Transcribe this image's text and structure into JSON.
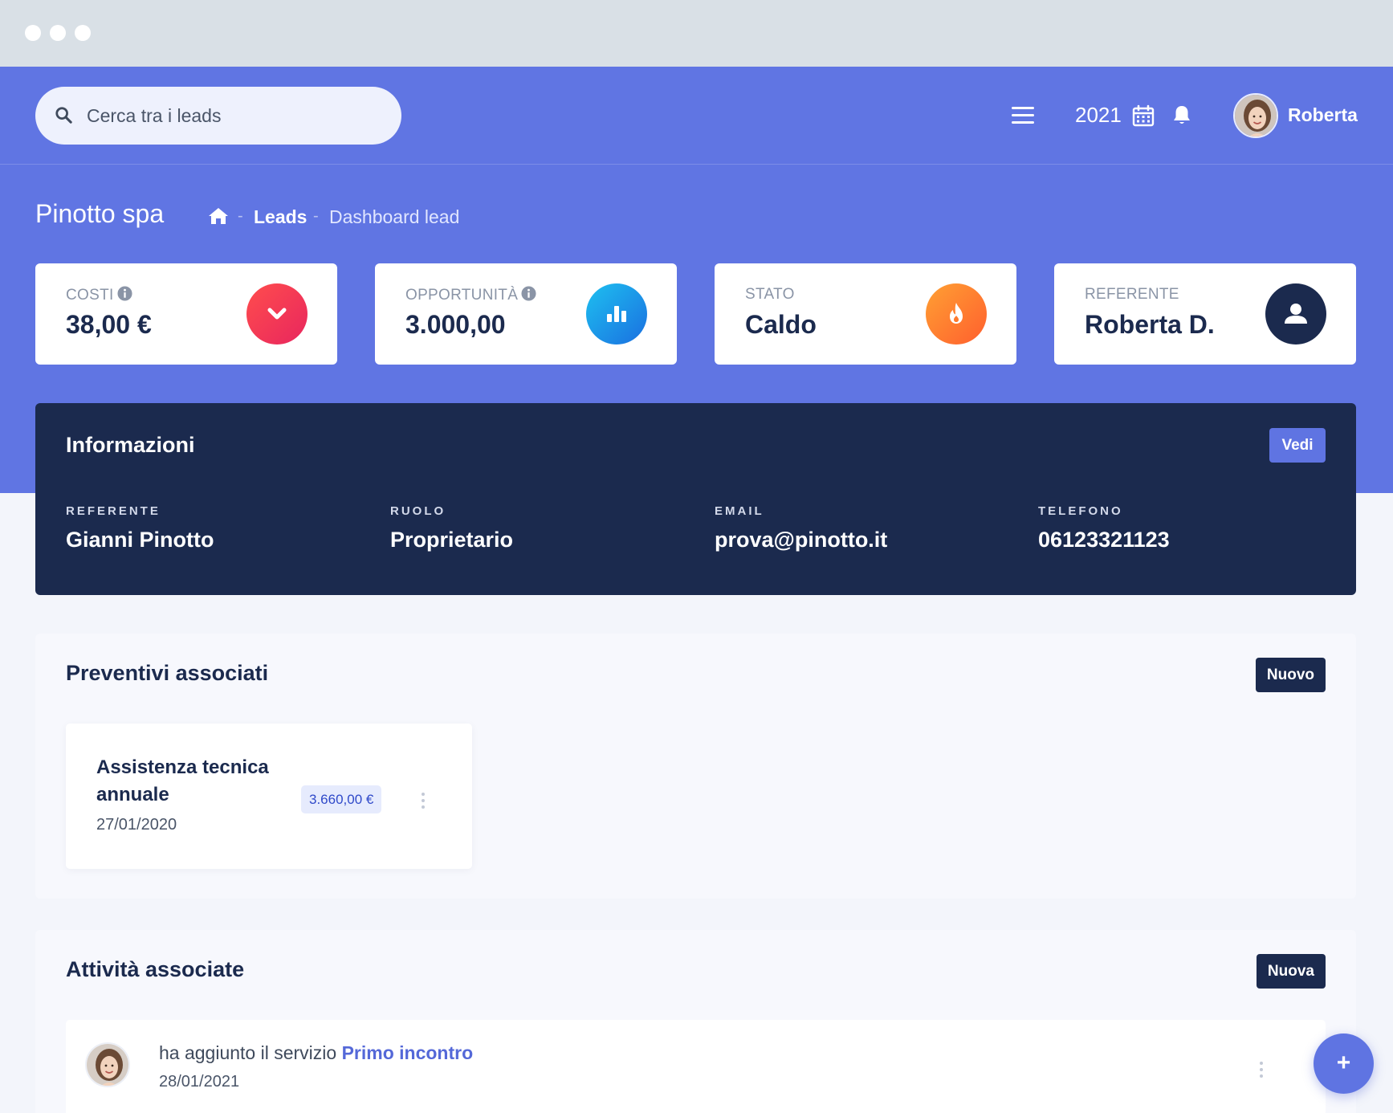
{
  "header": {
    "search_placeholder": "Cerca tra i leads",
    "year": "2021",
    "user_name": "Roberta"
  },
  "page": {
    "title": "Pinotto spa",
    "breadcrumb": [
      "Leads",
      "Dashboard lead"
    ]
  },
  "stats": [
    {
      "label": "COSTI",
      "value": "38,00 €",
      "icon": "chevron-down-icon",
      "color": "#f0335a"
    },
    {
      "label": "OPPORTUNITÀ",
      "value": "3.000,00",
      "icon": "bar-chart-icon",
      "color": "#1a9be6"
    },
    {
      "label": "STATO",
      "value": "Caldo",
      "icon": "fire-icon",
      "color": "#ff7a2e"
    },
    {
      "label": "REFERENTE",
      "value": "Roberta D.",
      "icon": "user-icon",
      "color": "#1b2a4e"
    }
  ],
  "info": {
    "title": "Informazioni",
    "button": "Vedi",
    "fields": [
      {
        "label": "REFERENTE",
        "value": "Gianni Pinotto"
      },
      {
        "label": "RUOLO",
        "value": "Proprietario"
      },
      {
        "label": "EMAIL",
        "value": "prova@pinotto.it"
      },
      {
        "label": "TELEFONO",
        "value": "06123321123"
      }
    ]
  },
  "quotes": {
    "title": "Preventivi associati",
    "button": "Nuovo",
    "items": [
      {
        "title": "Assistenza tecnica annuale",
        "amount": "3.660,00 €",
        "date": "27/01/2020"
      }
    ]
  },
  "activities": {
    "title": "Attività associate",
    "button": "Nuova",
    "items": [
      {
        "text": "ha aggiunto il servizio",
        "link": "Primo incontro",
        "date": "28/01/2021"
      }
    ]
  },
  "fab": {
    "label": "+"
  },
  "colors": {
    "primary": "#6075e3",
    "navy": "#1b2a4e",
    "background": "#f3f5fb"
  }
}
